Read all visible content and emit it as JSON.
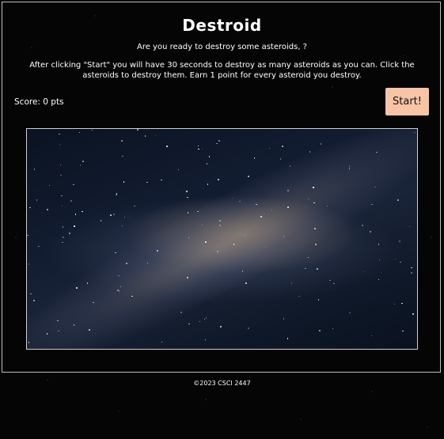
{
  "header": {
    "title": "Destroid",
    "subtitle": "Are you ready to destroy some asteroids, ?",
    "instructions": "After clicking \"Start\" you will have 30 seconds to destroy as many asteroids as you can. Click the asteroids to destroy them. Earn 1 point for every asteroid you destroy."
  },
  "game": {
    "score_label": "Score: 0 pts",
    "start_label": "Start!"
  },
  "footer": {
    "copyright": "©2023 CSCI 2447"
  },
  "colors": {
    "start_button_bg": "#f7c4a5",
    "border": "#d0d0d0",
    "background": "#000000"
  }
}
